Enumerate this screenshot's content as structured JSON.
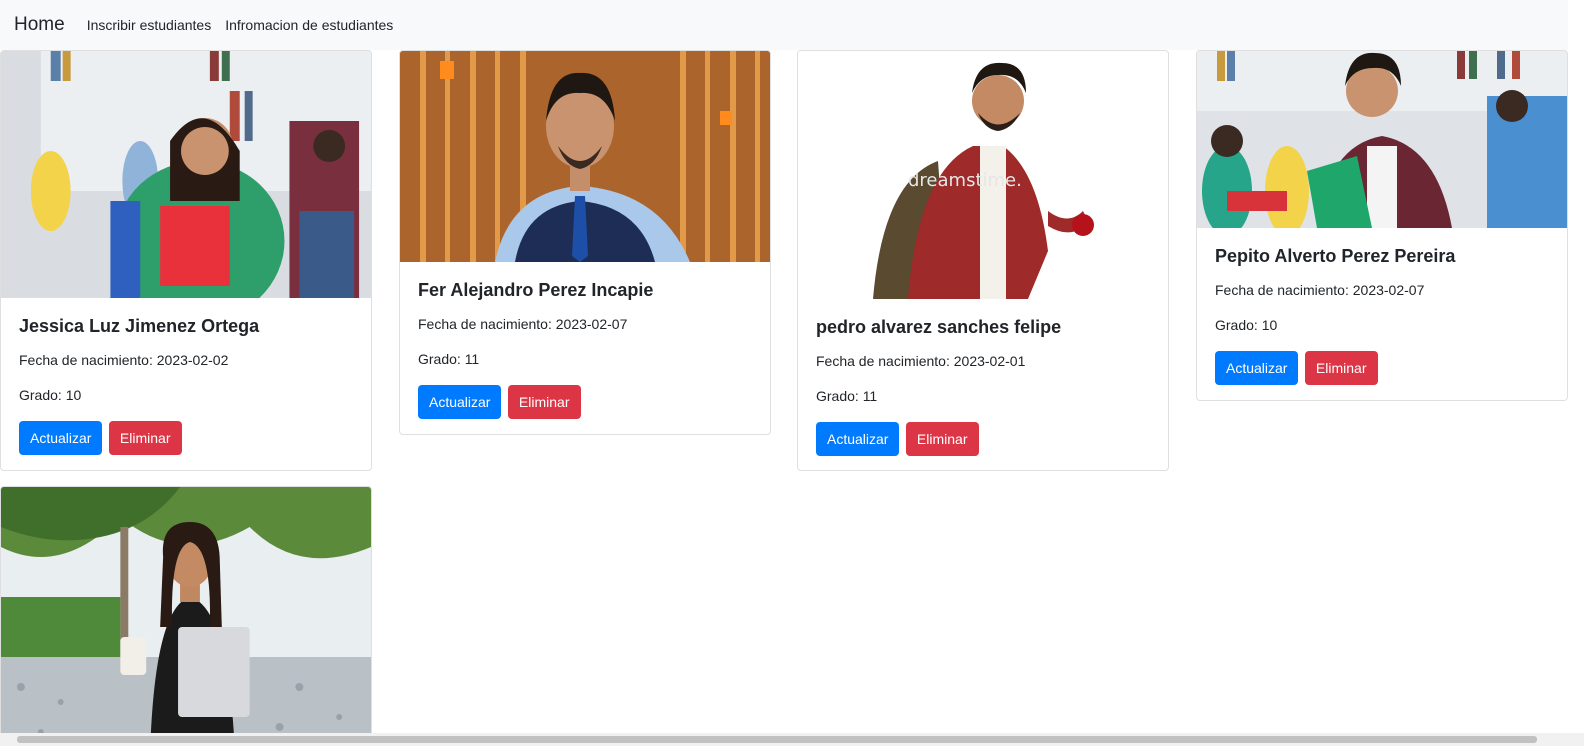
{
  "navbar": {
    "brand": "Home",
    "links": [
      "Inscribir estudiantes",
      "Infromacion de estudiantes"
    ]
  },
  "students": [
    {
      "name": "Jessica Luz Jimenez Ortega",
      "birth": "Fecha de nacimiento: 2023-02-02",
      "grade": "Grado: 10",
      "update_label": "Actualizar",
      "delete_label": "Eliminar"
    },
    {
      "name": "Fer Alejandro Perez Incapie",
      "birth": "Fecha de nacimiento: 2023-02-07",
      "grade": "Grado: 11",
      "update_label": "Actualizar",
      "delete_label": "Eliminar"
    },
    {
      "name": "pedro alvarez sanches felipe",
      "birth": "Fecha de nacimiento: 2023-02-01",
      "grade": "Grado: 11",
      "update_label": "Actualizar",
      "delete_label": "Eliminar"
    },
    {
      "name": "Pepito Alverto Perez Pereira",
      "birth": "Fecha de nacimiento: 2023-02-07",
      "grade": "Grado: 10",
      "update_label": "Actualizar",
      "delete_label": "Eliminar"
    }
  ],
  "colors": {
    "primary": "#007bff",
    "danger": "#dc3545",
    "navbar_bg": "#f8f9fa"
  }
}
